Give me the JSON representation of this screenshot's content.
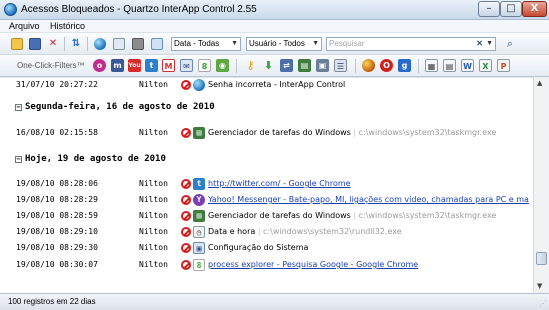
{
  "window": {
    "title": "Acessos Bloqueados - Quartzo InterApp Control 2.55",
    "min_label": "–",
    "max_label": "□",
    "close_label": "X"
  },
  "menu": {
    "items": [
      {
        "label": "Arquivo"
      },
      {
        "label": "Histórico"
      }
    ]
  },
  "toolbar": {
    "date_filter": "Data - Todas",
    "user_filter": "Usuário - Todos",
    "search_placeholder": "Pesquisar"
  },
  "filters_bar": {
    "label": "One-Click-Filters™"
  },
  "log": {
    "rows_top": [
      {
        "datetime": "31/07/10 20:27:22",
        "user": "Nilton",
        "title": "Senha incorreta - InterApp Control",
        "path": "",
        "icon": "globe-icon"
      }
    ],
    "groups": [
      {
        "header": "Segunda-feira, 16 de agosto de 2010",
        "rows": [
          {
            "datetime": "16/08/10 02:15:58",
            "user": "Nilton",
            "title": "Gerenciador de tarefas do Windows",
            "path": "c:\\windows\\system32\\taskmgr.exe",
            "icon": "taskmgr-icon"
          }
        ]
      },
      {
        "header": "Hoje, 19 de agosto de 2010",
        "rows": [
          {
            "datetime": "19/08/10 08:28:06",
            "user": "Nilton",
            "title": "http://twitter.com/ - Google Chrome",
            "path": "",
            "icon": "twitter-icon"
          },
          {
            "datetime": "19/08/10 08:28:29",
            "user": "Nilton",
            "title": "Yahoo! Messenger - Bate-papo, MI, ligações com vídeo, chamadas para PC e ma",
            "path": "",
            "icon": "yahoo-icon"
          },
          {
            "datetime": "19/08/10 08:28:59",
            "user": "Nilton",
            "title": "Gerenciador de tarefas do Windows",
            "path": "c:\\windows\\system32\\taskmgr.exe",
            "icon": "taskmgr-icon"
          },
          {
            "datetime": "19/08/10 08:29:10",
            "user": "Nilton",
            "title": "Data e hora",
            "path": "c:\\windows\\system32\\rundll32.exe",
            "icon": "datetime-icon"
          },
          {
            "datetime": "19/08/10 08:29:30",
            "user": "Nilton",
            "title": "Configuração do Sistema",
            "path": "",
            "icon": "sysconfig-icon"
          },
          {
            "datetime": "19/08/10 08:30:07",
            "user": "Nilton",
            "title": "process explorer - Pesquisa Google - Google Chrome",
            "path": "",
            "icon": "google-icon"
          }
        ]
      }
    ]
  },
  "status": {
    "text": "100 registros em 22 dias"
  }
}
